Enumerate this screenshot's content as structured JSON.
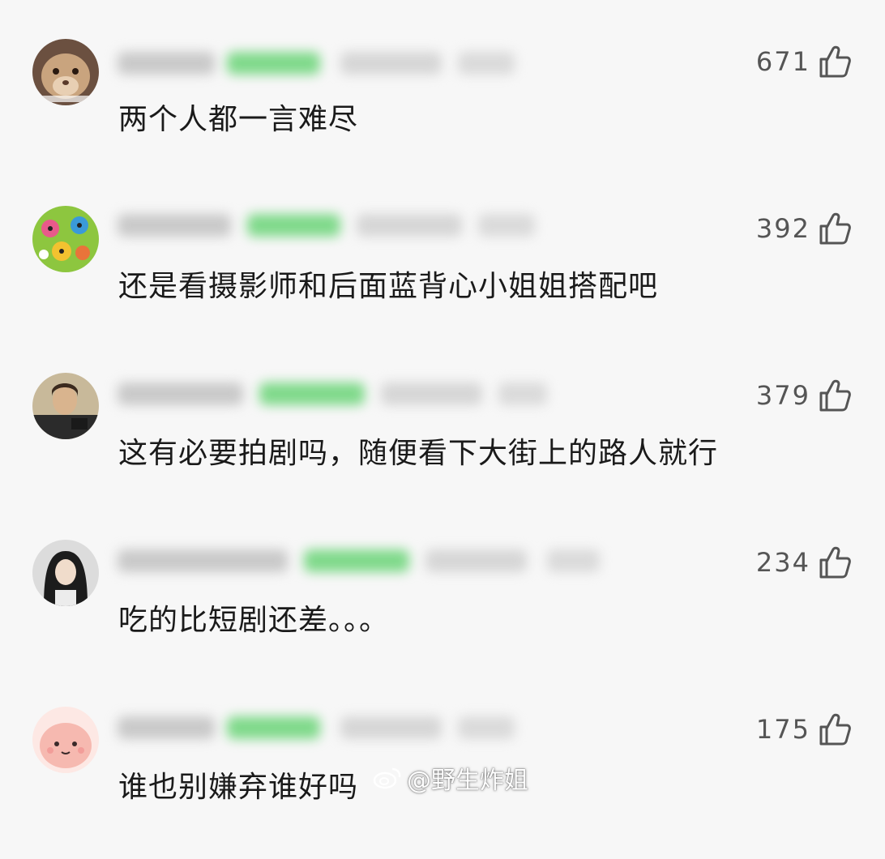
{
  "comments": [
    {
      "text": "两个人都一言难尽",
      "likes": "671"
    },
    {
      "text": "还是看摄影师和后面蓝背心小姐姐搭配吧",
      "likes": "392"
    },
    {
      "text": "这有必要拍剧吗，随便看下大街上的路人就行",
      "likes": "379"
    },
    {
      "text": "吃的比短剧还差。。。",
      "likes": "234"
    },
    {
      "text": "谁也别嫌弃谁好吗",
      "likes": "175"
    }
  ],
  "watermark": {
    "handle": "@野生炸姐"
  },
  "icons": {
    "like": "thumbs-up-icon",
    "watermark": "weibo-icon"
  },
  "colors": {
    "background": "#f7f7f7",
    "text": "#1a1a1a",
    "count": "#555555",
    "badge": "#7fd98a"
  }
}
